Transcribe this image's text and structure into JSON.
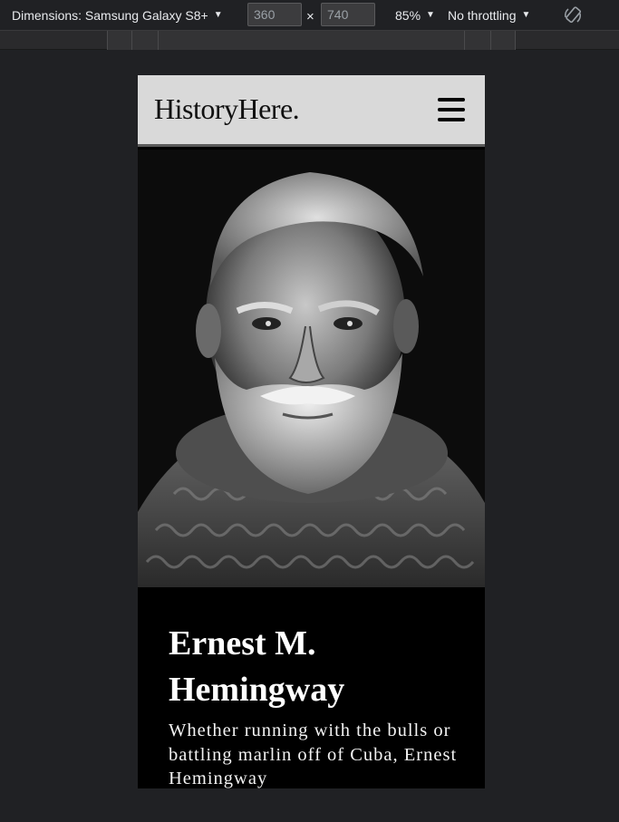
{
  "devtools": {
    "dimensions_label": "Dimensions: Samsung Galaxy S8+",
    "width_value": "360",
    "times_symbol": "×",
    "height_value": "740",
    "zoom_label": "85%",
    "throttling_label": "No throttling",
    "caret_glyph": "▼",
    "rotate_icon": "rotate-icon"
  },
  "site": {
    "logo": "HistoryHere.",
    "menu_icon": "hamburger-menu-icon",
    "hero_alt": "Black and white portrait of Ernest Hemingway in a turtleneck sweater",
    "title": "Ernest M. Hemingway",
    "blurb": "Whether running with the bulls or battling marlin off of Cuba, Ernest Hemingway"
  }
}
